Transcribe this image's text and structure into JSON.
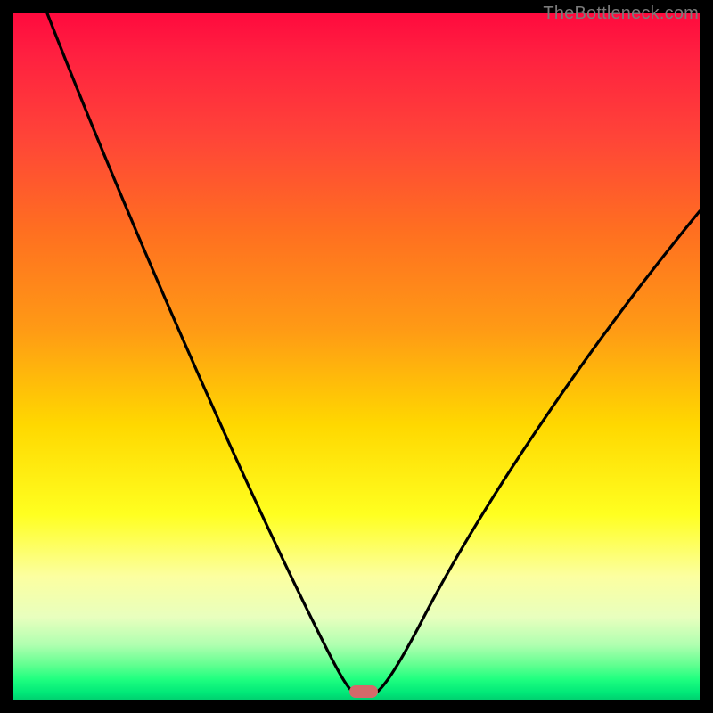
{
  "watermark": "TheBottleneck.com",
  "chart_data": {
    "type": "line",
    "title": "",
    "xlabel": "",
    "ylabel": "",
    "xlim": [
      0,
      100
    ],
    "ylim": [
      0,
      100
    ],
    "grid": false,
    "x": [
      0,
      3,
      6,
      9,
      12,
      15,
      18,
      21,
      24,
      27,
      30,
      33,
      36,
      39,
      42,
      45,
      47,
      49,
      50,
      51,
      52,
      53,
      55,
      58,
      62,
      66,
      70,
      75,
      80,
      85,
      90,
      95,
      100
    ],
    "values": [
      100,
      94,
      88,
      82,
      76,
      70,
      64,
      58,
      52,
      46,
      40,
      34,
      28,
      22,
      16,
      9,
      4,
      1,
      0,
      0,
      0,
      1,
      4,
      10,
      17,
      23,
      29,
      36,
      43,
      50,
      56,
      62,
      68
    ],
    "optimal_point": {
      "x": 51,
      "y": 0
    },
    "background_gradient": {
      "top": "#ff0a3e",
      "mid": "#ffff20",
      "bottom": "#00d070"
    },
    "marker_color": "#d46a6a",
    "curve_color": "#000000"
  }
}
